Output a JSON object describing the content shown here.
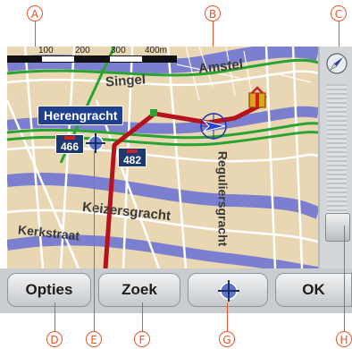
{
  "callouts": {
    "a": "A",
    "b": "B",
    "c": "C",
    "d": "D",
    "e": "E",
    "f": "F",
    "g": "G",
    "h": "H"
  },
  "scale": {
    "labels": [
      "100",
      "200",
      "300",
      "400m"
    ]
  },
  "streets": {
    "singel": "Singel",
    "amstel": "Amstel",
    "reguliersgracht": "Reguliersgracht",
    "keizersgracht": "Keizersgracht",
    "kerkstraat": "Kerkstraat"
  },
  "place_label": "Herengracht",
  "route_shields": {
    "a": "466",
    "b": "482"
  },
  "toolbar": {
    "options_label": "Opties",
    "search_label": "Zoek",
    "ok_label": "OK"
  },
  "icons": {
    "compass": "compass-icon",
    "crosshair": "crosshair-icon",
    "destination": "destination-icon",
    "position": "position-arrow-icon"
  },
  "colors": {
    "route": "#b5121b",
    "map_bg": "#e9d7b4",
    "road_green": "#2aa335",
    "canal": "#7c7fcf",
    "callout": "#e8542a"
  }
}
